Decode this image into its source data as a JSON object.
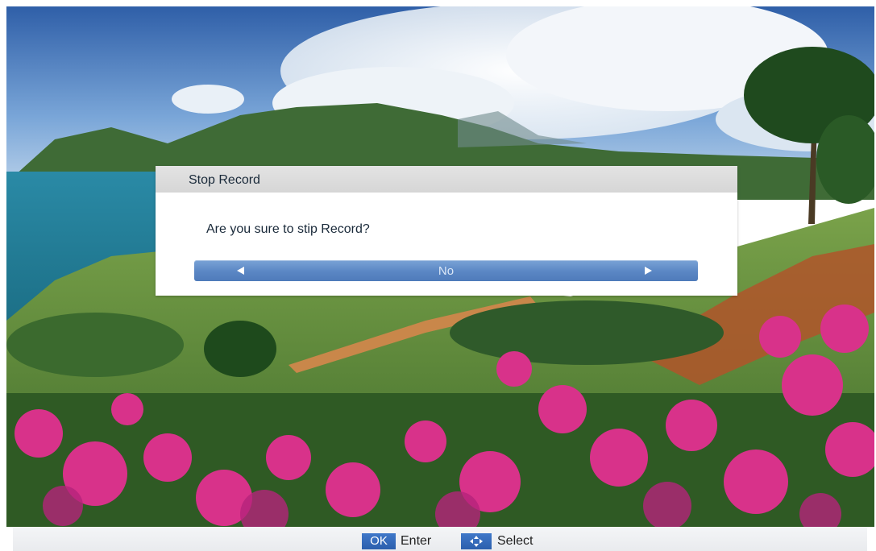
{
  "dialog": {
    "title": "Stop Record",
    "message": "Are you sure to stip Record?",
    "selector_value": "No"
  },
  "footer": {
    "ok_key": "OK",
    "ok_label": "Enter",
    "nav_label": "Select"
  },
  "icons": {
    "left": "arrow-left-icon",
    "right": "arrow-right-icon",
    "nav": "four-way-arrows-icon"
  },
  "colors": {
    "selector": "#5a86c4",
    "key_badge": "#2c5fad",
    "header": "#d6d6d6"
  }
}
